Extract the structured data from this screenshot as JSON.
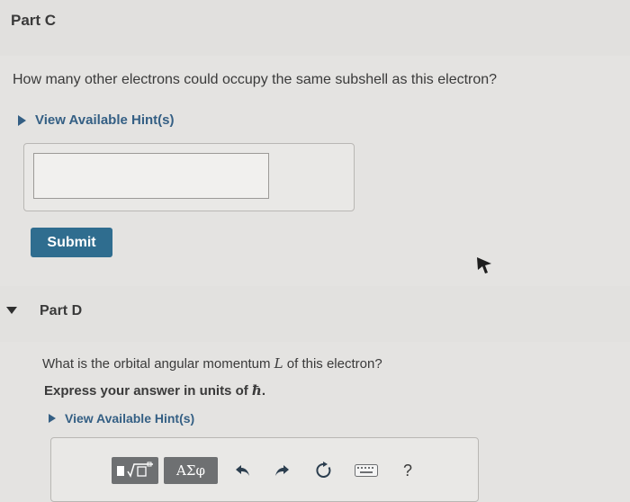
{
  "part_c": {
    "title": "Part C",
    "question": "How many other electrons could occupy the same subshell as this electron?",
    "hint_label": "View Available Hint(s)",
    "answer_value": "",
    "submit_label": "Submit"
  },
  "part_d": {
    "title": "Part D",
    "question_prefix": "What is the orbital angular momentum ",
    "question_var": "L",
    "question_suffix": " of this electron?",
    "instruction_prefix": "Express your answer in units of ",
    "instruction_unit": "ħ",
    "instruction_suffix": ".",
    "hint_label": "View Available Hint(s)",
    "toolbar": {
      "greek_label": "ΑΣφ",
      "help_label": "?"
    }
  },
  "icons": [
    "template-icon",
    "greek-letters-icon",
    "undo-icon",
    "redo-icon",
    "reset-icon",
    "keyboard-icon",
    "help-icon",
    "mouse-cursor-icon",
    "hint-expand-icon",
    "collapse-icon"
  ]
}
